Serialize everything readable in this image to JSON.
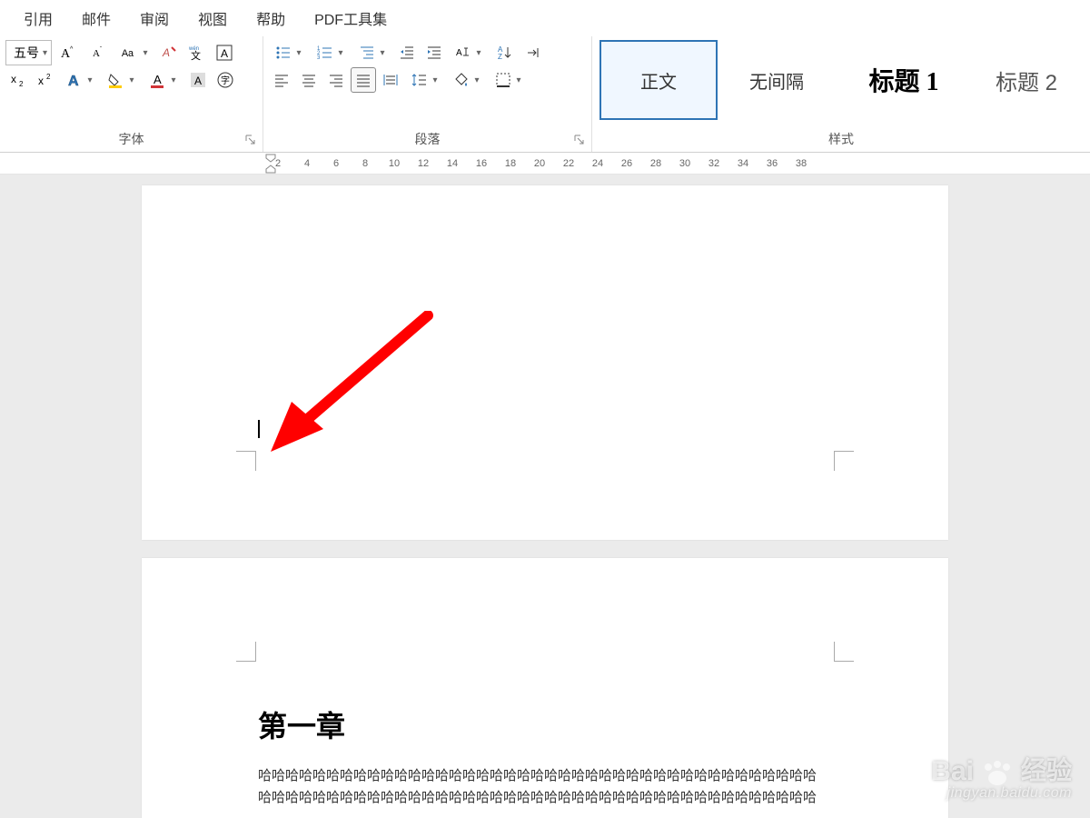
{
  "menu": {
    "items": [
      "引用",
      "邮件",
      "审阅",
      "视图",
      "帮助",
      "PDF工具集"
    ]
  },
  "font_group": {
    "label": "字体",
    "size_selected": "五号",
    "tools": {
      "grow": "A^",
      "shrink": "A^",
      "change_case": "Aa",
      "clear": "清",
      "phonetic": "拼音",
      "char_border": "A",
      "sub": "x2",
      "sup": "x2",
      "text_effect": "A",
      "highlight": "ab",
      "font_color": "A",
      "char_shade": "A",
      "enclose": "字"
    }
  },
  "paragraph_group": {
    "label": "段落"
  },
  "styles_group": {
    "label": "样式",
    "items": [
      {
        "label": "正文",
        "selected": true,
        "cls": ""
      },
      {
        "label": "无间隔",
        "selected": false,
        "cls": ""
      },
      {
        "label": "标题 1",
        "selected": false,
        "cls": "heading1"
      },
      {
        "label": "标题 2",
        "selected": false,
        "cls": "heading2"
      }
    ]
  },
  "ruler": {
    "ticks": [
      "2",
      "4",
      "6",
      "8",
      "10",
      "12",
      "14",
      "16",
      "18",
      "20",
      "22",
      "24",
      "26",
      "28",
      "30",
      "32",
      "34",
      "36",
      "38"
    ]
  },
  "document": {
    "page2_heading": "第一章",
    "page2_line1": "哈哈哈哈哈哈哈哈哈哈哈哈哈哈哈哈哈哈哈哈哈哈哈哈哈哈哈哈哈哈哈哈哈哈哈哈哈哈哈哈哈",
    "page2_line2": "哈哈哈哈哈哈哈哈哈哈哈哈哈哈哈哈哈哈哈哈哈哈哈哈哈哈哈哈哈哈哈哈哈哈哈哈哈哈哈哈哈"
  },
  "watermark": {
    "brand_left": "Bai",
    "brand_right": "经验",
    "url": "jingyan.baidu.com"
  }
}
